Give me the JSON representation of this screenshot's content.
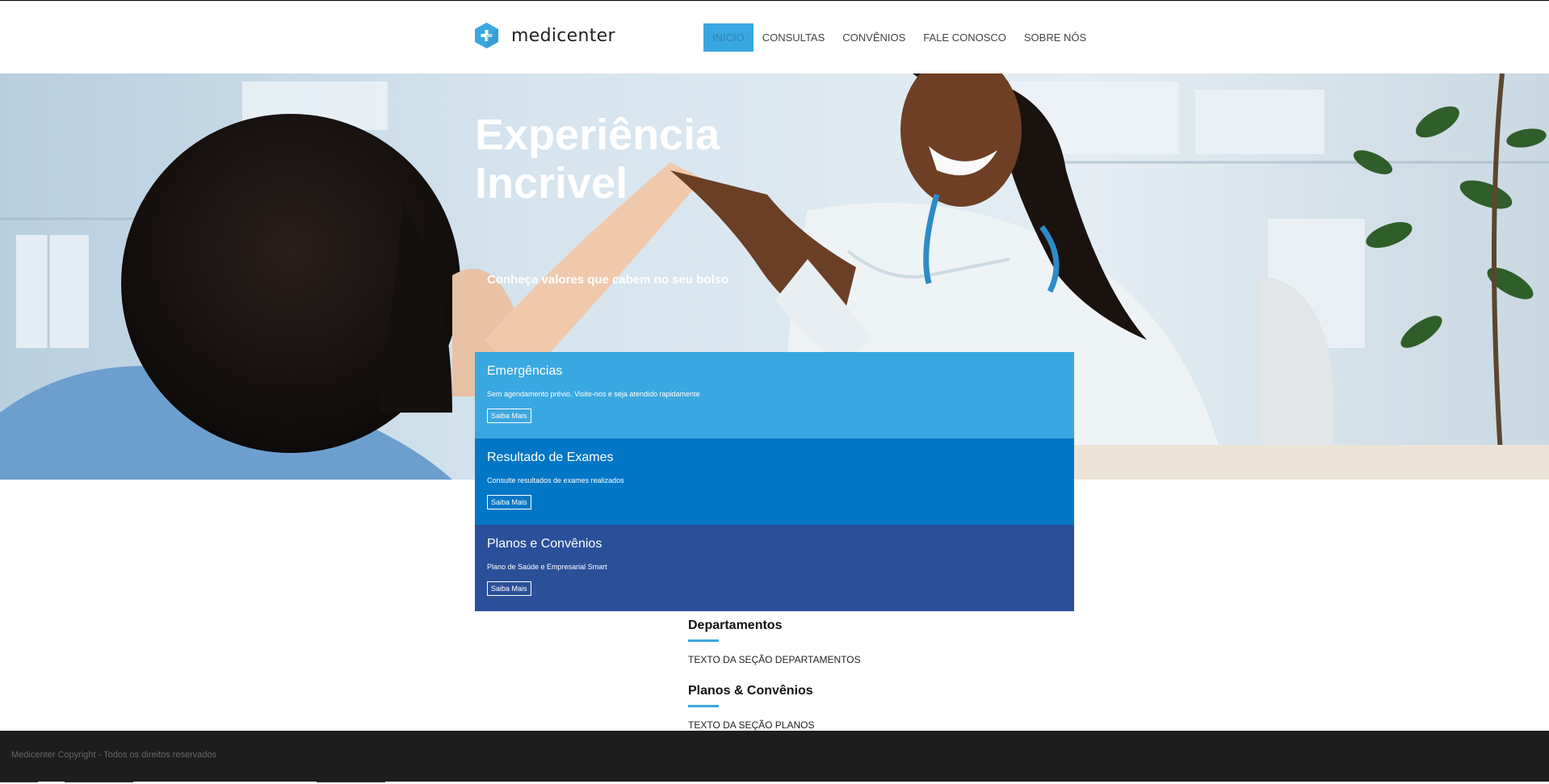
{
  "brand": {
    "name": "medicenter",
    "icon": "cross-hexagon-icon",
    "color": "#3aa8e0"
  },
  "nav": [
    {
      "label": "INICIO",
      "active": true
    },
    {
      "label": "CONSULTAS",
      "active": false
    },
    {
      "label": "CONVÊNIOS",
      "active": false
    },
    {
      "label": "FALE CONOSCO",
      "active": false
    },
    {
      "label": "SOBRE NÓS",
      "active": false
    }
  ],
  "hero": {
    "title_line1": "Experiência",
    "title_line2": "Incrivel",
    "subtitle": "Conheça valores que cabem no seu bolso"
  },
  "boxes": [
    {
      "title": "Emergências",
      "text": "Sem agendamento prévio. Visite-nos e seja atendido rapidamente",
      "button": "Saiba Mais",
      "color": "#3aa8e0"
    },
    {
      "title": "Resultado de Exames",
      "text": "Consulte resultados de exames realizados",
      "button": "Saiba Mais",
      "color": "#0277c6"
    },
    {
      "title": "Planos e Convênios",
      "text": "Plano de Saúde e Empresarial Smart",
      "button": "Saiba Mais",
      "color": "#2c4f9a"
    }
  ],
  "sections": [
    {
      "title": "Departamentos",
      "text": "TEXTO DA SEÇÃO DEPARTAMENTOS"
    },
    {
      "title": "Planos & Convênios",
      "text": "TEXTO DA SEÇÃO PLANOS"
    }
  ],
  "footer": {
    "text": "Medicenter Copyright - Todos os direitos reservados"
  }
}
